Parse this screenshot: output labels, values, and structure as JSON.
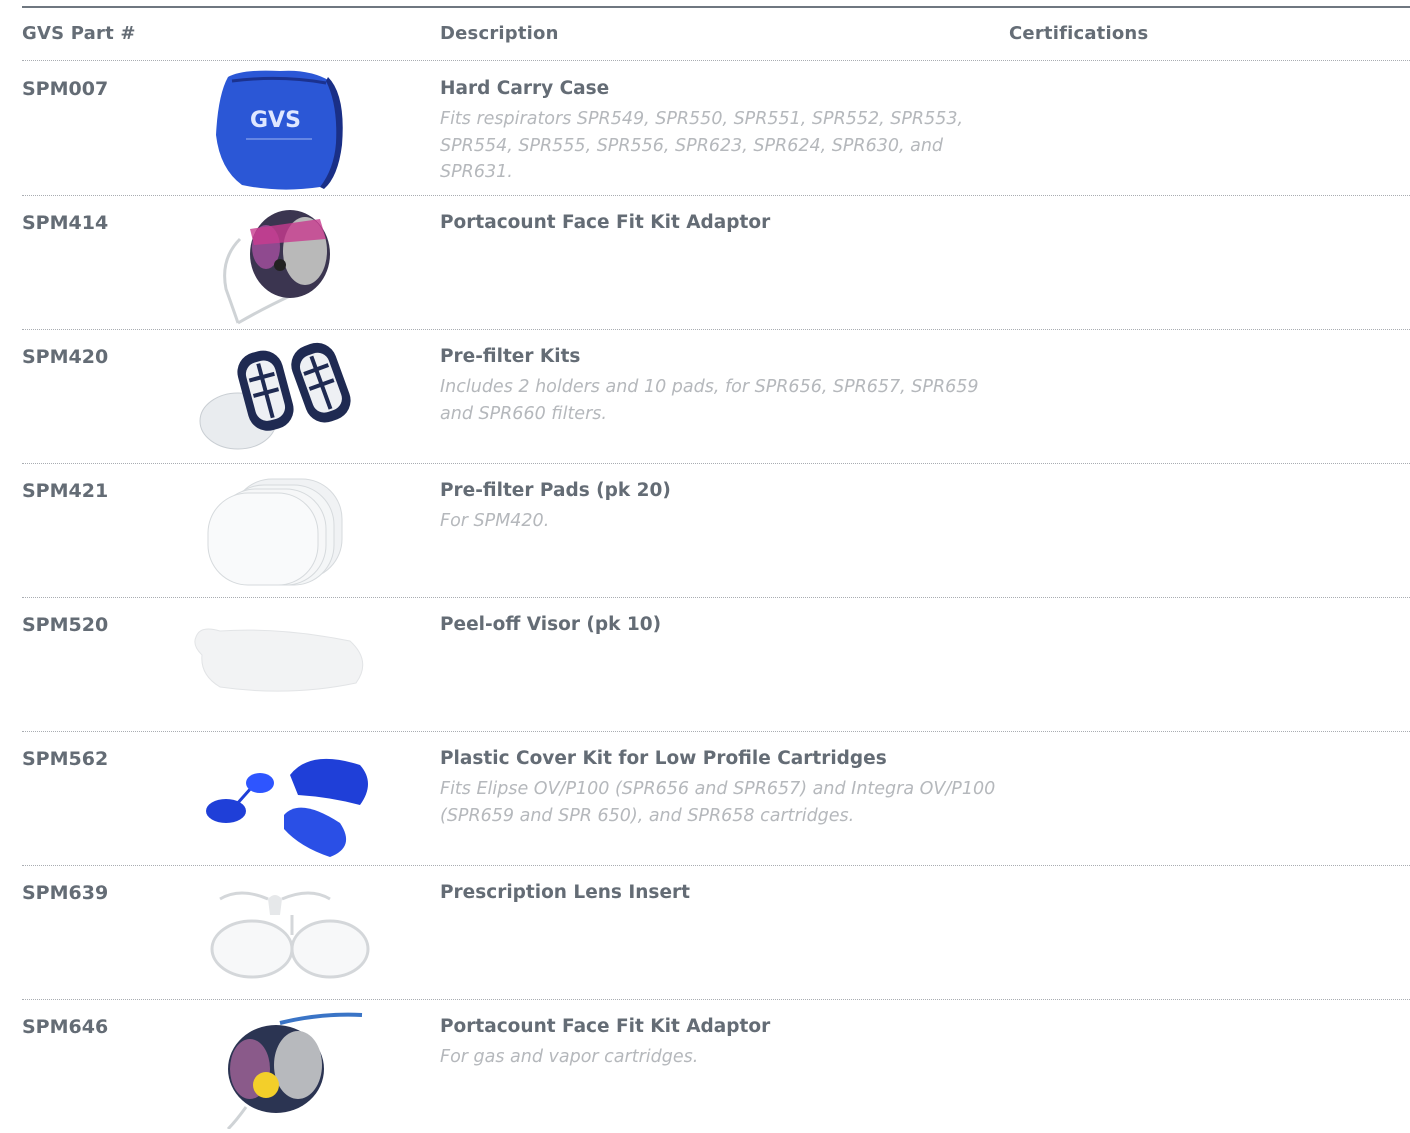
{
  "table": {
    "headers": {
      "part": "GVS Part #",
      "description": "Description",
      "certifications": "Certifications"
    },
    "rows": [
      {
        "part": "SPM007",
        "image_icon": "hard-carry-case-image",
        "title": "Hard Carry Case",
        "note": "Fits respirators SPR549, SPR550, SPR551, SPR552, SPR553, SPR554, SPR555, SPR556, SPR623, SPR624, SPR630, and SPR631."
      },
      {
        "part": "SPM414",
        "image_icon": "half-mask-with-tube-image",
        "title": "Portacount Face Fit Kit Adaptor",
        "note": ""
      },
      {
        "part": "SPM420",
        "image_icon": "prefilter-holders-image",
        "title": "Pre-filter Kits",
        "note": "Includes 2 holders and 10 pads, for SPR656, SPR657, SPR659 and SPR660 filters."
      },
      {
        "part": "SPM421",
        "image_icon": "prefilter-pads-image",
        "title": "Pre-filter Pads (pk 20)",
        "note": "For SPM420."
      },
      {
        "part": "SPM520",
        "image_icon": "peel-off-visor-image",
        "title": "Peel-off Visor (pk 10)",
        "note": ""
      },
      {
        "part": "SPM562",
        "image_icon": "plastic-covers-image",
        "title": "Plastic Cover Kit for Low Profile Cartridges",
        "note": "Fits Elipse OV/P100 (SPR656 and SPR657) and Integra OV/P100 (SPR659 and SPR 650), and SPR658 cartridges."
      },
      {
        "part": "SPM639",
        "image_icon": "prescription-lens-frame-image",
        "title": "Prescription Lens Insert",
        "note": ""
      },
      {
        "part": "SPM646",
        "image_icon": "mask-adaptor-image",
        "title": "Portacount Face Fit Kit Adaptor",
        "note": "For gas and vapor cartridges."
      }
    ]
  },
  "colors": {
    "text": "#646c75",
    "muted": "#b5b8bc",
    "rule": "#6f7780",
    "brand_blue": "#2a4fc4"
  }
}
